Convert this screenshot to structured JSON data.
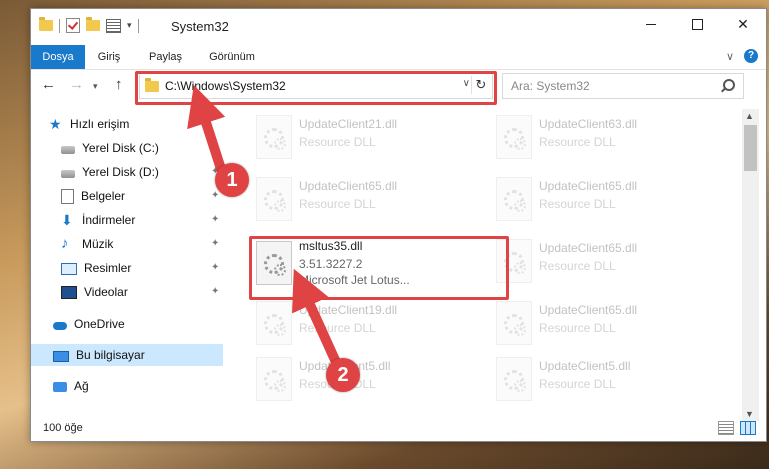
{
  "window": {
    "title": "System32"
  },
  "ribbon": {
    "tabs": [
      {
        "label": "Dosya",
        "active": true
      },
      {
        "label": "Giriş"
      },
      {
        "label": "Paylaş"
      },
      {
        "label": "Görünüm"
      }
    ],
    "help": "?"
  },
  "nav": {
    "back": "←",
    "forward": "→",
    "up": "↑",
    "address": "C:\\Windows\\System32",
    "search_placeholder": "Ara: System32"
  },
  "sidebar": {
    "items": [
      {
        "label": "Hızlı erişim"
      },
      {
        "label": "Yerel Disk (C:)"
      },
      {
        "label": "Yerel Disk (D:)"
      },
      {
        "label": "Belgeler"
      },
      {
        "label": "İndirmeler"
      },
      {
        "label": "Müzik"
      },
      {
        "label": "Resimler"
      },
      {
        "label": "Videolar"
      },
      {
        "label": "OneDrive"
      },
      {
        "label": "Bu bilgisayar",
        "selected": true
      },
      {
        "label": "Ağ"
      }
    ]
  },
  "files": {
    "r0c0": {
      "name": "UpdateClient21.dll",
      "type": "Resource DLL"
    },
    "r0c1": {
      "name": "UpdateClient63.dll",
      "type": "Resource DLL"
    },
    "r1c0": {
      "name": "UpdateClient65.dll",
      "type": "Resource DLL"
    },
    "r1c1": {
      "name": "UpdateClient65.dll",
      "type": "Resource DLL"
    },
    "highlight": {
      "name": "msltus35.dll",
      "version": "3.51.3227.2",
      "description": "Microsoft Jet Lotus..."
    },
    "r2c1": {
      "name": "UpdateClient65.dll",
      "type": "Resource DLL"
    },
    "r3c0": {
      "name": "UpdateClient19.dll",
      "type": "Resource DLL"
    },
    "r3c1": {
      "name": "UpdateClient65.dll",
      "type": "Resource DLL"
    },
    "r4c0": {
      "name": "UpdateClient5.dll",
      "type": "Resource DLL"
    },
    "r4c1": {
      "name": "UpdateClient5.dll",
      "type": "Resource DLL"
    }
  },
  "status": {
    "count": "100 öğe"
  },
  "callouts": {
    "one": "1",
    "two": "2",
    "color": "#e04343"
  },
  "colors": {
    "accent": "#1979ca",
    "highlight": "#e04343"
  }
}
